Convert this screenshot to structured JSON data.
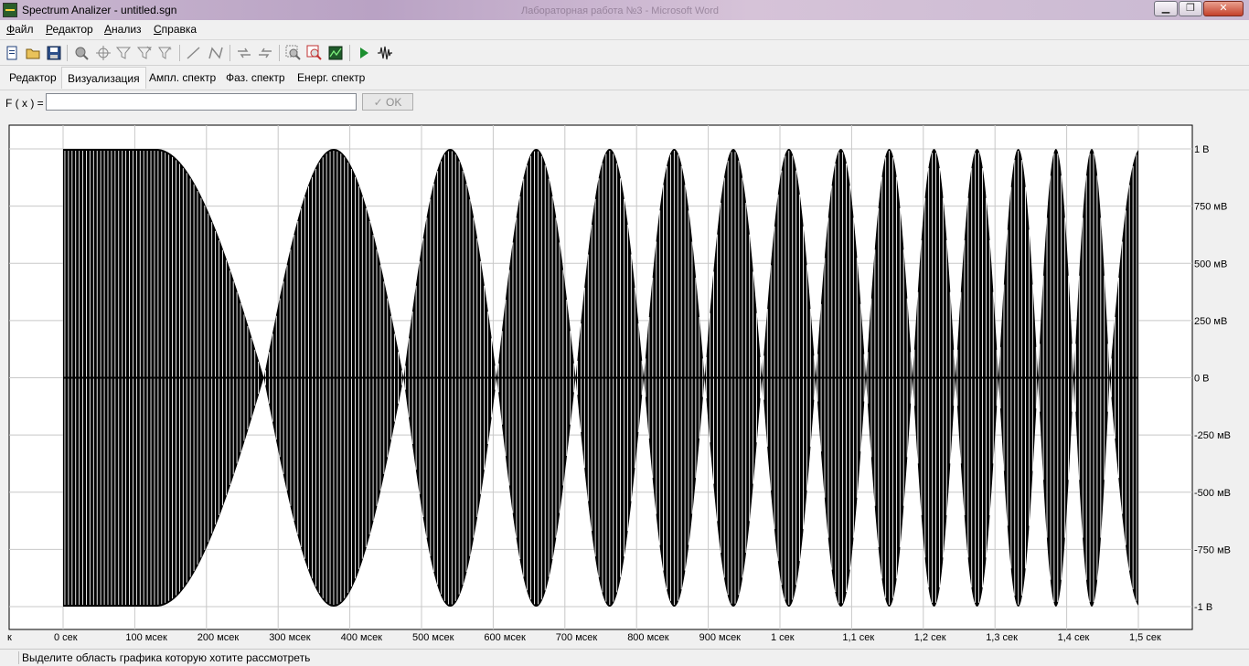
{
  "window": {
    "title": "Spectrum Analizer - untitled.sgn",
    "background_title": "Лабораторная работа №3 - Microsoft Word",
    "buttons": {
      "minimize": "▁",
      "maximize": "❐",
      "close": "✕"
    }
  },
  "menu": {
    "items": [
      {
        "key": "file",
        "underline": "Ф",
        "rest": "айл"
      },
      {
        "key": "editor",
        "underline": "Р",
        "rest": "едактор"
      },
      {
        "key": "analysis",
        "underline": "А",
        "rest": "нализ"
      },
      {
        "key": "help",
        "underline": "С",
        "rest": "правка"
      }
    ]
  },
  "toolbar": {
    "icons": [
      "new-file-icon",
      "open-folder-icon",
      "save-disk-icon",
      "zoom-icon",
      "crosshair-icon",
      "filter-icon",
      "filter-alt-icon",
      "filter-star-icon",
      "line-icon",
      "polyline-icon",
      "shift-left-icon",
      "shift-right-icon",
      "zoom-region-icon",
      "zoom-cancel-icon",
      "chart-icon",
      "play-icon",
      "signal-icon"
    ]
  },
  "tabs": [
    {
      "label": "Редактор",
      "active": false
    },
    {
      "label": "Визуализация",
      "active": true
    },
    {
      "label": "Ампл. спектр",
      "active": false
    },
    {
      "label": "Фаз. спектр",
      "active": false
    },
    {
      "label": "Енерг. спектр",
      "active": false
    }
  ],
  "formula": {
    "label": "F ( x ) =",
    "value": "",
    "ok_label": "OK"
  },
  "status": {
    "text": "Выделите область графика которую хотите рассмотреть"
  },
  "chart_data": {
    "type": "line",
    "description_type": "chirp-like sampled signal envelope",
    "x_unit": "seconds",
    "x_range": [
      0,
      1.5
    ],
    "y_range": [
      -1,
      1
    ],
    "grid": true,
    "x_ticks": [
      {
        "value": 0.0,
        "label": "0 сек"
      },
      {
        "value": 0.1,
        "label": "100 мсек"
      },
      {
        "value": 0.2,
        "label": "200 мсек"
      },
      {
        "value": 0.3,
        "label": "300 мсек"
      },
      {
        "value": 0.4,
        "label": "400 мсек"
      },
      {
        "value": 0.5,
        "label": "500 мсек"
      },
      {
        "value": 0.6,
        "label": "600 мсек"
      },
      {
        "value": 0.7,
        "label": "700 мсек"
      },
      {
        "value": 0.8,
        "label": "800 мсек"
      },
      {
        "value": 0.9,
        "label": "900 мсек"
      },
      {
        "value": 1.0,
        "label": "1 сек"
      },
      {
        "value": 1.1,
        "label": "1,1 сек"
      },
      {
        "value": 1.2,
        "label": "1,2 сек"
      },
      {
        "value": 1.3,
        "label": "1,3 сек"
      },
      {
        "value": 1.4,
        "label": "1,4 сек"
      },
      {
        "value": 1.5,
        "label": "1,5 сек"
      }
    ],
    "x_left_partial_label": "к",
    "y_ticks": [
      {
        "value": 1.0,
        "label": "1 В"
      },
      {
        "value": 0.75,
        "label": "750 мВ"
      },
      {
        "value": 0.5,
        "label": "500 мВ"
      },
      {
        "value": 0.25,
        "label": "250 мВ"
      },
      {
        "value": 0.0,
        "label": "0 В"
      },
      {
        "value": -0.25,
        "label": "-250 мВ"
      },
      {
        "value": -0.5,
        "label": "-500 мВ"
      },
      {
        "value": -0.75,
        "label": "-750 мВ"
      },
      {
        "value": -1.0,
        "label": "-1 В"
      }
    ],
    "envelope_zero_crossings_s": [
      0.28,
      0.475,
      0.605,
      0.715,
      0.81,
      0.895,
      0.975,
      1.05,
      1.12,
      1.185,
      1.245,
      1.305,
      1.36,
      1.41,
      1.46
    ],
    "sample_step_s": 0.005
  }
}
